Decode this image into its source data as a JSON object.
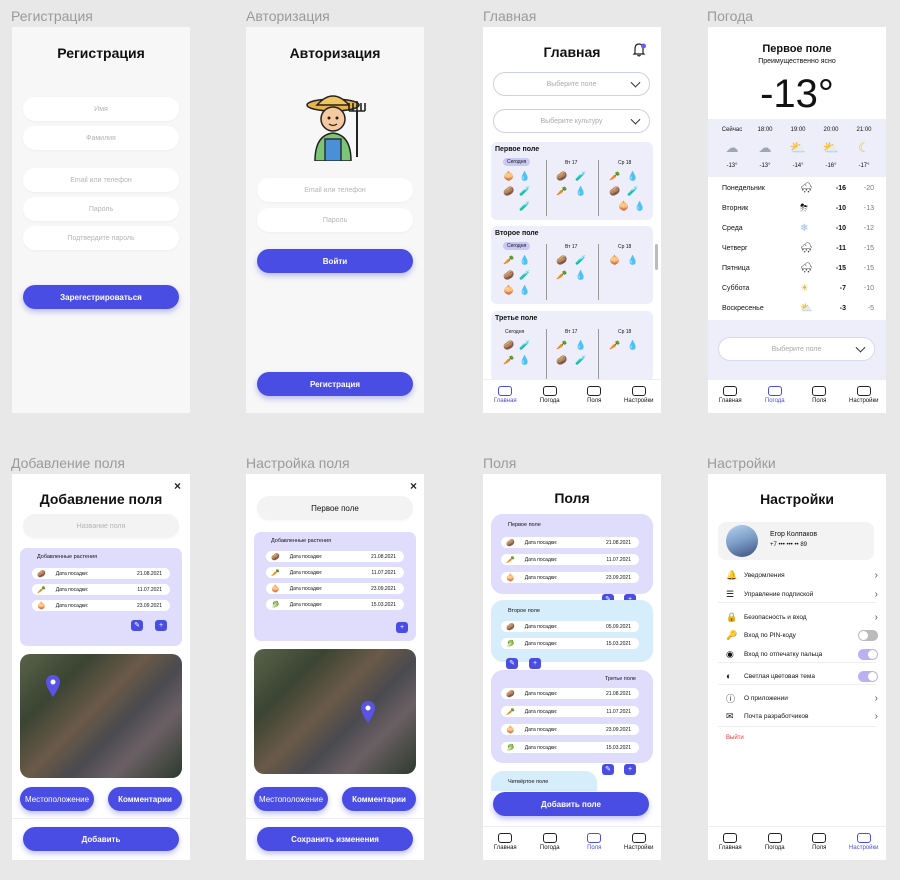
{
  "labels": [
    "Регистрация",
    "Авторизация",
    "Главная",
    "Погода",
    "Добавление поля",
    "Настройка поля",
    "Поля",
    "Настройки"
  ],
  "registration": {
    "title": "Регистрация",
    "fields": [
      "Имя",
      "Фамилия",
      "Email или телефон",
      "Пароль",
      "Подтвердите пароль"
    ],
    "button": "Зарегестрироваться"
  },
  "auth": {
    "title": "Авторизация",
    "fields": [
      "Email или телефон",
      "Пароль"
    ],
    "login": "Войти",
    "register": "Регистрация"
  },
  "main": {
    "title": "Главная",
    "select_field": "Выберите поле",
    "select_crop": "Выберите культуру",
    "fields": [
      {
        "name": "Первое поле",
        "days": [
          "Сегодня",
          "Вт 17",
          "Ср 18"
        ]
      },
      {
        "name": "Второе поле",
        "days": [
          "Сегодня",
          "Вт 17",
          "Ср 18"
        ]
      },
      {
        "name": "Третье поле",
        "days": [
          "Сегодня",
          "Вт 17",
          "Ср 18"
        ]
      }
    ]
  },
  "nav": [
    "Главная",
    "Погода",
    "Поля",
    "Настройки"
  ],
  "weather": {
    "title": "Первое поле",
    "subtitle": "Преимущественно ясно",
    "temp": "-13°",
    "hours": [
      {
        "t": "Сейчас",
        "v": "-13°",
        "i": "☁"
      },
      {
        "t": "18:00",
        "v": "-13°",
        "i": "☁"
      },
      {
        "t": "19:00",
        "v": "-14°",
        "i": "⛅"
      },
      {
        "t": "20:00",
        "v": "-16°",
        "i": "⛅"
      },
      {
        "t": "21:00",
        "v": "-17°",
        "i": "☾"
      }
    ],
    "days": [
      {
        "d": "Понедельник",
        "i": "🌨",
        "h": "-16",
        "l": "-20"
      },
      {
        "d": "Вторник",
        "i": "⛈",
        "h": "-10",
        "l": "-13"
      },
      {
        "d": "Среда",
        "i": "❄",
        "h": "-10",
        "l": "-12"
      },
      {
        "d": "Четверг",
        "i": "🌨",
        "h": "-11",
        "l": "-15"
      },
      {
        "d": "Пятница",
        "i": "🌨",
        "h": "-15",
        "l": "-15"
      },
      {
        "d": "Суббота",
        "i": "☀",
        "h": "-7",
        "l": "-10"
      },
      {
        "d": "Воскресенье",
        "i": "⛅",
        "h": "-3",
        "l": "-5"
      }
    ],
    "select_field": "Выберите поле"
  },
  "add_field": {
    "title": "Добавление поля",
    "name_placeholder": "Название поля",
    "plants_title": "Добавленные растения",
    "plants": [
      {
        "i": "🥔",
        "l": "Дата посадки:",
        "d": "21.08.2021"
      },
      {
        "i": "🥕",
        "l": "Дата посадки:",
        "d": "11.07.2021"
      },
      {
        "i": "🧅",
        "l": "Дата посадки:",
        "d": "23.09.2021"
      }
    ],
    "location": "Местоположение",
    "comments": "Комментарии",
    "add": "Добавить"
  },
  "edit_field": {
    "name": "Первое поле",
    "plants_title": "Добавленные растения",
    "plants": [
      {
        "i": "🥔",
        "l": "Дата посадки:",
        "d": "21.08.2021"
      },
      {
        "i": "🥕",
        "l": "Дата посадки:",
        "d": "11.07.2021"
      },
      {
        "i": "🧅",
        "l": "Дата посадки:",
        "d": "23.09.2021"
      },
      {
        "i": "🥬",
        "l": "Дата посадки:",
        "d": "15.03.2021"
      }
    ],
    "location": "Местоположение",
    "comments": "Комментарии",
    "save": "Сохранить изменения"
  },
  "fields_list": {
    "title": "Поля",
    "groups": [
      {
        "name": "Первое поле",
        "rows": [
          {
            "i": "🥔",
            "l": "Дата посадки:",
            "d": "21.08.2021"
          },
          {
            "i": "🥕",
            "l": "Дата посадки:",
            "d": "11.07.2021"
          },
          {
            "i": "🧅",
            "l": "Дата посадки:",
            "d": "23.09.2021"
          }
        ]
      },
      {
        "name": "Второе поле",
        "rows": [
          {
            "i": "🥔",
            "l": "Дата посадки:",
            "d": "05.09.2021"
          },
          {
            "i": "🥬",
            "l": "Дата посадки:",
            "d": "15.03.2021"
          }
        ]
      },
      {
        "name": "Третье поле",
        "rows": [
          {
            "i": "🥔",
            "l": "Дата посадки:",
            "d": "21.08.2021"
          },
          {
            "i": "🥕",
            "l": "Дата посадки:",
            "d": "11.07.2021"
          },
          {
            "i": "🧅",
            "l": "Дата посадки:",
            "d": "23.09.2021"
          },
          {
            "i": "🥬",
            "l": "Дата посадки:",
            "d": "15.03.2021"
          }
        ]
      },
      {
        "name": "Четвёртое поле",
        "rows": []
      }
    ],
    "add": "Добавить поле"
  },
  "settings": {
    "title": "Настройки",
    "user": "Егор Колпаков",
    "phone": "+7 ••• ••• •• 89",
    "items": [
      {
        "l": "Уведомления",
        "i": "🔔",
        "t": "chev"
      },
      {
        "l": "Управление подпиской",
        "i": "☰",
        "t": "chev"
      },
      {
        "l": "Безопасность и вход",
        "i": "🔒",
        "t": "chev"
      },
      {
        "l": "Вход по PIN-коду",
        "i": "🔑",
        "t": "off"
      },
      {
        "l": "Вход по отпечатку пальца",
        "i": "◉",
        "t": "on"
      },
      {
        "l": "Светлая цветовая тема",
        "i": "◐",
        "t": "on"
      },
      {
        "l": "О приложении",
        "i": "ⓘ",
        "t": "chev"
      },
      {
        "l": "Почта разработчиков",
        "i": "✉",
        "t": "chev"
      }
    ],
    "logout": "Выйти"
  },
  "colors": {
    "accent": "#4a4de3",
    "lavender": "#e0dcfb",
    "lightblue": "#d6eefc",
    "danger": "#e23b3b"
  }
}
